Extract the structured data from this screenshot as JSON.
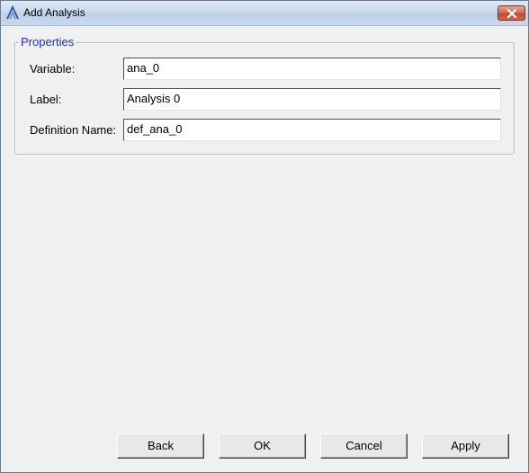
{
  "window": {
    "title": "Add Analysis",
    "icon": "altair-logo-icon",
    "close_icon": "close-x-icon"
  },
  "properties": {
    "legend": "Properties",
    "fields": [
      {
        "label": "Variable:",
        "value": "ana_0"
      },
      {
        "label": "Label:",
        "value": "Analysis 0"
      },
      {
        "label": "Definition Name:",
        "value": "def_ana_0"
      }
    ]
  },
  "buttons": {
    "back": "Back",
    "ok": "OK",
    "cancel": "Cancel",
    "apply": "Apply"
  },
  "colors": {
    "legend_text": "#1f35b8",
    "close_button": "#c44a30",
    "dialog_background": "#f0f0f0"
  }
}
